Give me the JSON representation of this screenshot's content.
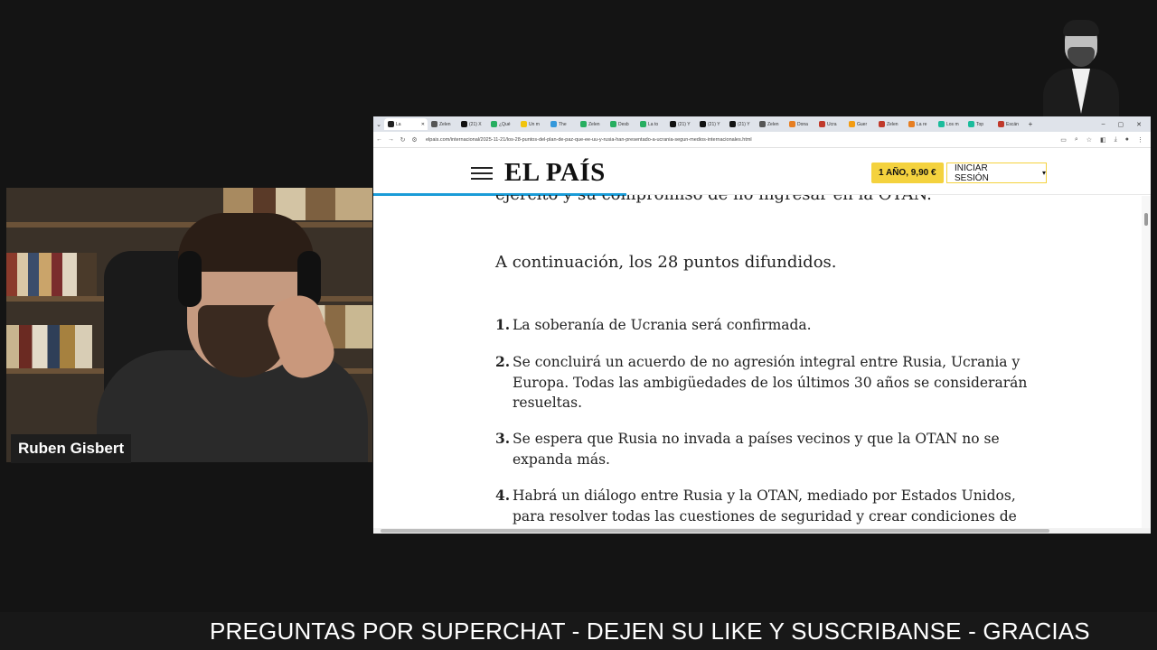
{
  "webcam": {
    "name_label": "Ruben Gisbert"
  },
  "browser": {
    "tabs": [
      {
        "label": "La",
        "color": "#222222",
        "active": true
      },
      {
        "label": "Zelen",
        "color": "#555555"
      },
      {
        "label": "(21) X",
        "color": "#111111"
      },
      {
        "label": "¿Qué",
        "color": "#27ae60"
      },
      {
        "label": "Un m",
        "color": "#f1c40f"
      },
      {
        "label": "The",
        "color": "#3498db"
      },
      {
        "label": "Zelen",
        "color": "#27ae60"
      },
      {
        "label": "Desb",
        "color": "#27ae60"
      },
      {
        "label": "La to",
        "color": "#27ae60"
      },
      {
        "label": "(21) Y",
        "color": "#111111"
      },
      {
        "label": "(21) Y",
        "color": "#111111"
      },
      {
        "label": "(21) Y",
        "color": "#111111"
      },
      {
        "label": "Zelen",
        "color": "#555555"
      },
      {
        "label": "Dona",
        "color": "#e67e22"
      },
      {
        "label": "Ucra",
        "color": "#c0392b"
      },
      {
        "label": "Guer",
        "color": "#f39c12"
      },
      {
        "label": "Zelen",
        "color": "#c0392b"
      },
      {
        "label": "La re",
        "color": "#e67e22"
      },
      {
        "label": "Los m",
        "color": "#1abc9c"
      },
      {
        "label": "Top",
        "color": "#1abc9c"
      },
      {
        "label": "Escán",
        "color": "#c0392b"
      }
    ],
    "new_tab": "+",
    "window_controls": [
      "–",
      "▢",
      "✕"
    ],
    "url": "elpais.com/internacional/2025-11-21/los-28-puntos-del-plan-de-paz-que-ee-uu-y-rusia-han-presentado-a-ucrania-segun-medios-internacionales.html"
  },
  "site": {
    "logo": "EL PAÍS",
    "subscribe_label": "1 AÑO, 9,90 €",
    "login_label": "INICIAR SESIÓN",
    "login_caret": "▾"
  },
  "article": {
    "cut_line": "ejército y su compromiso de no ingresar en la OTAN.",
    "intro": "A continuación, los 28 puntos difundidos.",
    "points": [
      {
        "num": "1.",
        "text": "La soberanía de Ucrania será confirmada."
      },
      {
        "num": "2.",
        "text": "Se concluirá un acuerdo de no agresión integral entre Rusia, Ucrania y Europa. Todas las ambigüedades de los últimos 30 años se considerarán resueltas."
      },
      {
        "num": "3.",
        "text": "Se espera que Rusia no invada a países vecinos y que la OTAN no se expanda más."
      },
      {
        "num": "4.",
        "text": "Habrá un diálogo entre Rusia y la OTAN, mediado por Estados Unidos, para resolver todas las cuestiones de seguridad y crear condiciones de"
      }
    ]
  },
  "banner": {
    "text": "PREGUNTAS POR SUPERCHAT - DEJEN SU LIKE Y SUSCRIBANSE - GRACIAS"
  }
}
